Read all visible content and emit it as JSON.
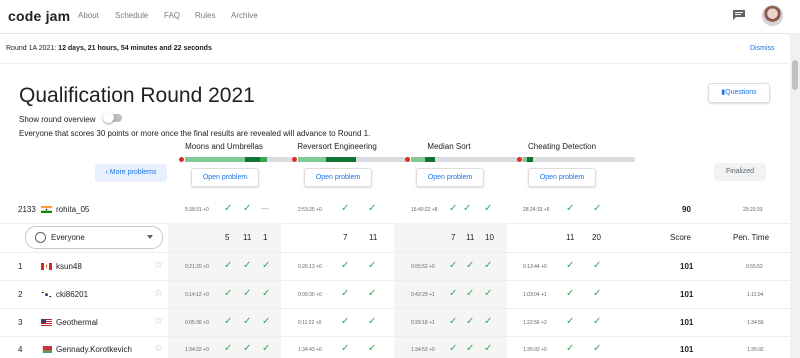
{
  "nav": {
    "logo": "code jam",
    "links": [
      "About",
      "Schedule",
      "FAQ",
      "Rules",
      "Archive"
    ]
  },
  "banner": {
    "label": "Round 1A 2021:",
    "countdown": "12 days, 21 hours, 54 minutes and 22 seconds",
    "dismiss": "Dismiss"
  },
  "page": {
    "title": "Qualification Round 2021",
    "questions_button": "Questions",
    "overview_label": "Show round overview",
    "advance_text": "Everyone that scores 30 points or more once the final results are revealed will advance to Round 1.",
    "more_problems": "More problems",
    "finalized": "Finalized"
  },
  "problems": [
    {
      "name": "Moons and Umbrellas",
      "open": "Open problem"
    },
    {
      "name": "Reversort Engineering",
      "open": "Open problem"
    },
    {
      "name": "Median Sort",
      "open": "Open problem"
    },
    {
      "name": "Cheating Detection",
      "open": "Open problem"
    }
  ],
  "my_row": {
    "rank": "2133",
    "user": "rohita_05",
    "times": [
      "5:38:31 +0",
      "2:53:25 +0",
      "15:40:22 +8",
      "28:24:33 +6"
    ],
    "score": "90",
    "penalty": "29:20:33"
  },
  "table_header": {
    "filter": "Everyone",
    "p1_counts": [
      "5",
      "11",
      "1"
    ],
    "p2_counts": [
      "7",
      "11"
    ],
    "p3_counts": [
      "7",
      "11",
      "10"
    ],
    "p4_counts": [
      "11",
      "20"
    ],
    "score": "Score",
    "penalty": "Pen. Time"
  },
  "rows": [
    {
      "rank": "1",
      "name": "ksun48",
      "times": [
        "0:21:20 +0",
        "0:26:13 +0",
        "0:55:52 +0",
        "0:13:44 +0"
      ],
      "score": "101",
      "penalty": "0:55:52"
    },
    {
      "rank": "2",
      "name": "cki86201",
      "times": [
        "0:14:12 +0",
        "0:09:30 +0",
        "0:42:29 +1",
        "1:03:04 +1"
      ],
      "score": "101",
      "penalty": "1:11:04"
    },
    {
      "rank": "3",
      "name": "Geothermal",
      "times": [
        "0:05:36 +0",
        "0:11:22 +0",
        "0:29:18 +1",
        "1:22:56 +2"
      ],
      "score": "101",
      "penalty": "1:34:56"
    },
    {
      "rank": "4",
      "name": "Gennady.Korotkevich",
      "times": [
        "1:34:32 +0",
        "1:34:43 +0",
        "1:34:53 +0",
        "1:35:02 +0"
      ],
      "score": "101",
      "penalty": "1:35:02"
    }
  ],
  "colors": {
    "accent": "#1a73e8",
    "check": "#34a853",
    "bar_green": "#34a853",
    "bar_dark": "#137333",
    "bar_red": "#d93025"
  }
}
